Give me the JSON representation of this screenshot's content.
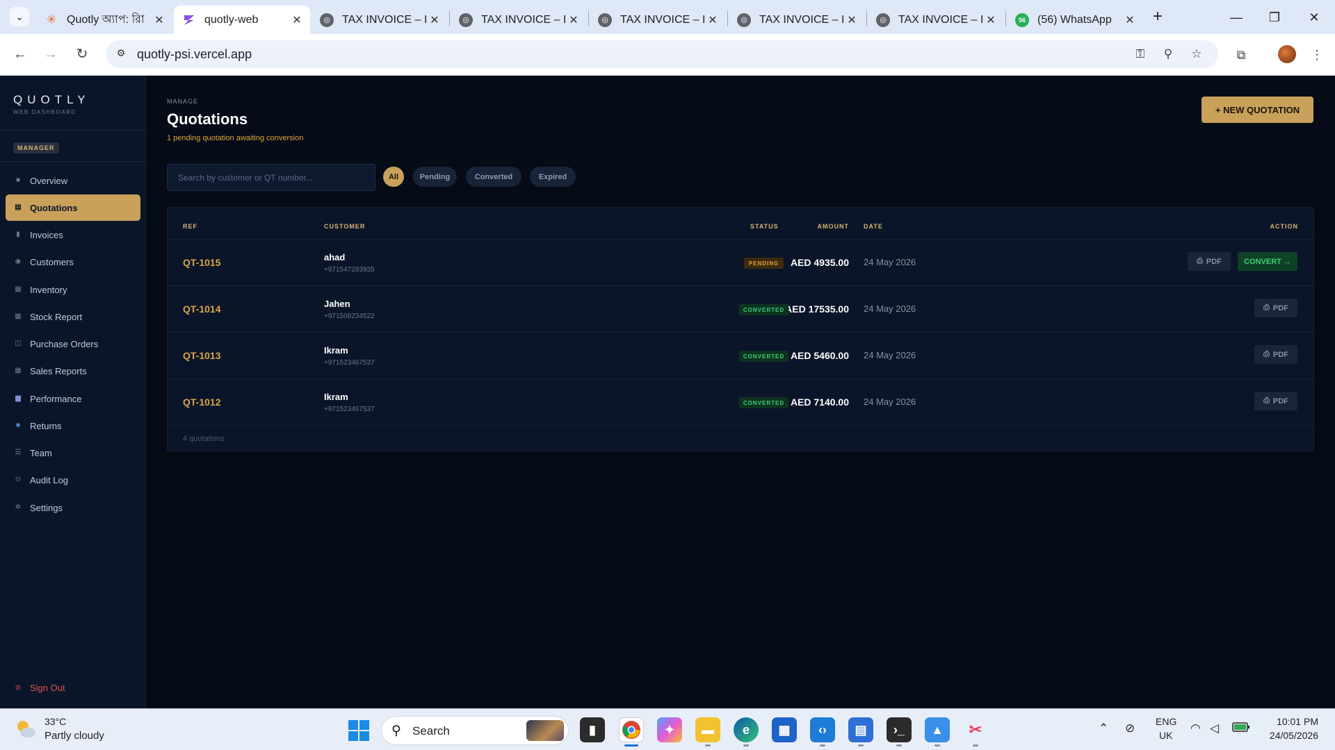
{
  "browser": {
    "tabs": [
      {
        "title": "Quotly অ্যাপ: রিা",
        "favicon": "sparkle-icon",
        "active": false
      },
      {
        "title": "quotly-web",
        "favicon": "bolt-icon",
        "active": true
      },
      {
        "title": "TAX INVOICE – I",
        "favicon": "globe-icon",
        "active": false
      },
      {
        "title": "TAX INVOICE – I",
        "favicon": "globe-icon",
        "active": false
      },
      {
        "title": "TAX INVOICE – I",
        "favicon": "globe-icon",
        "active": false
      },
      {
        "title": "TAX INVOICE – I",
        "favicon": "globe-icon",
        "active": false
      },
      {
        "title": "TAX INVOICE – I",
        "favicon": "globe-icon",
        "active": false
      },
      {
        "title": "(56) WhatsApp",
        "favicon": "whatsapp-icon",
        "active": false
      }
    ],
    "whatsapp_badge": "56",
    "url": "quotly-psi.vercel.app"
  },
  "sidebar": {
    "logo": "QUOTLY",
    "logo_sub": "WEB DASHBOARD",
    "role": "MANAGER",
    "items": [
      {
        "label": "Overview",
        "icon": "grid-icon",
        "active": false
      },
      {
        "label": "Quotations",
        "icon": "document-icon",
        "active": true
      },
      {
        "label": "Invoices",
        "icon": "receipt-icon",
        "active": false
      },
      {
        "label": "Customers",
        "icon": "user-icon",
        "active": false
      },
      {
        "label": "Inventory",
        "icon": "box-icon",
        "active": false
      },
      {
        "label": "Stock Report",
        "icon": "report-icon",
        "active": false
      },
      {
        "label": "Purchase Orders",
        "icon": "cart-icon",
        "active": false
      },
      {
        "label": "Sales Reports",
        "icon": "chart-icon",
        "active": false
      },
      {
        "label": "Performance",
        "icon": "bar-chart-icon",
        "active": false
      },
      {
        "label": "Returns",
        "icon": "return-icon",
        "active": false
      },
      {
        "label": "Team",
        "icon": "team-icon",
        "active": false
      },
      {
        "label": "Audit Log",
        "icon": "log-icon",
        "active": false
      },
      {
        "label": "Settings",
        "icon": "gear-icon",
        "active": false
      }
    ],
    "signout": "Sign Out"
  },
  "page": {
    "eyebrow": "MANAGE",
    "title": "Quotations",
    "subtitle": "1 pending quotation awaiting conversion",
    "new_button": "+ NEW QUOTATION",
    "search_placeholder": "Search by customer or QT number...",
    "filters": [
      {
        "label": "All",
        "active": true
      },
      {
        "label": "Pending",
        "active": false
      },
      {
        "label": "Converted",
        "active": false
      },
      {
        "label": "Expired",
        "active": false
      }
    ]
  },
  "table": {
    "headers": {
      "ref": "REF",
      "customer": "CUSTOMER",
      "amount": "AMOUNT",
      "status": "STATUS",
      "date": "DATE",
      "action": "ACTION"
    },
    "rows": [
      {
        "ref": "QT-1015",
        "name": "ahad",
        "phone": "+971547293935",
        "amount": "AED 4935.00",
        "status": "PENDING",
        "date": "24 May 2026",
        "pdf": "PDF",
        "convert": "CONVERT →"
      },
      {
        "ref": "QT-1014",
        "name": "Jahen",
        "phone": "+971508234522",
        "amount": "AED 17535.00",
        "status": "CONVERTED",
        "date": "24 May 2026",
        "pdf": "PDF",
        "convert": ""
      },
      {
        "ref": "QT-1013",
        "name": "Ikram",
        "phone": "+971523467537",
        "amount": "AED 5460.00",
        "status": "CONVERTED",
        "date": "24 May 2026",
        "pdf": "PDF",
        "convert": ""
      },
      {
        "ref": "QT-1012",
        "name": "Ikram",
        "phone": "+971523467537",
        "amount": "AED 7140.00",
        "status": "CONVERTED",
        "date": "24 May 2026",
        "pdf": "PDF",
        "convert": ""
      }
    ],
    "footer": "4 quotations"
  },
  "taskbar": {
    "temperature": "33°C",
    "weather": "Partly cloudy",
    "search": "Search",
    "lang_top": "ENG",
    "lang_bottom": "UK",
    "time": "10:01 PM",
    "date": "24/05/2026"
  },
  "colors": {
    "accent": "#c9a15a",
    "background": "#050b17",
    "sidebar": "#0b1529",
    "pending": "#e8a33c",
    "converted": "#3fd07a",
    "danger": "#e05252"
  }
}
